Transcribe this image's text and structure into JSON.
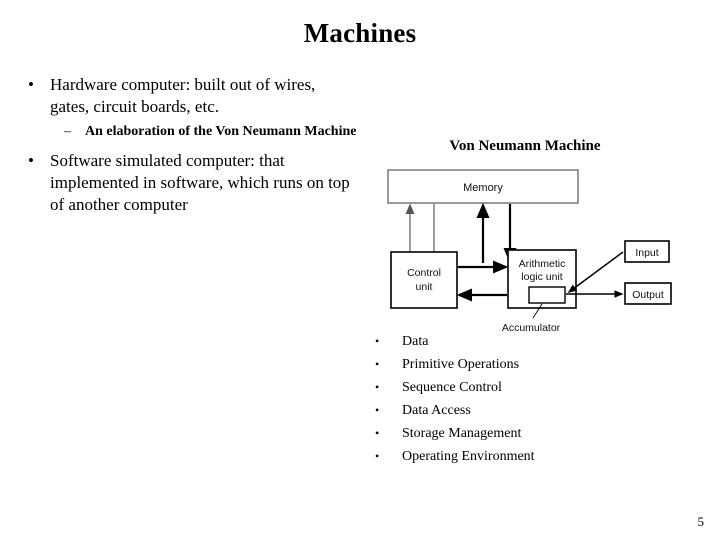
{
  "slide": {
    "title": "Machines",
    "page_number": "5",
    "background_color": "#ffffff",
    "text_color": "#000000"
  },
  "left_content": {
    "bullets": [
      {
        "marker": "•",
        "text": "Hardware computer: built out of wires, gates, circuit boards, etc.",
        "sub_bullets": [
          {
            "marker": "–",
            "text": "An elaboration of the Von Neumann Machine"
          }
        ]
      },
      {
        "marker": "•",
        "text": "Software simulated computer: that implemented in software, which runs on top of another computer",
        "sub_bullets": []
      }
    ]
  },
  "diagram": {
    "caption": "Von Neumann Machine",
    "boxes": {
      "memory": "Memory",
      "control_unit": "Control unit",
      "alu": "Arithmetic logic unit",
      "accumulator": "Accumulator",
      "input": "Input",
      "output": "Output"
    },
    "colors": {
      "memory_border": "#808080",
      "memory_arrow": "#808080",
      "box_border": "#000000",
      "arrow": "#000000"
    }
  },
  "right_list": {
    "marker": "•",
    "items": [
      "Data",
      "Primitive Operations",
      "Sequence Control",
      "Data Access",
      "Storage Management",
      "Operating Environment"
    ]
  }
}
